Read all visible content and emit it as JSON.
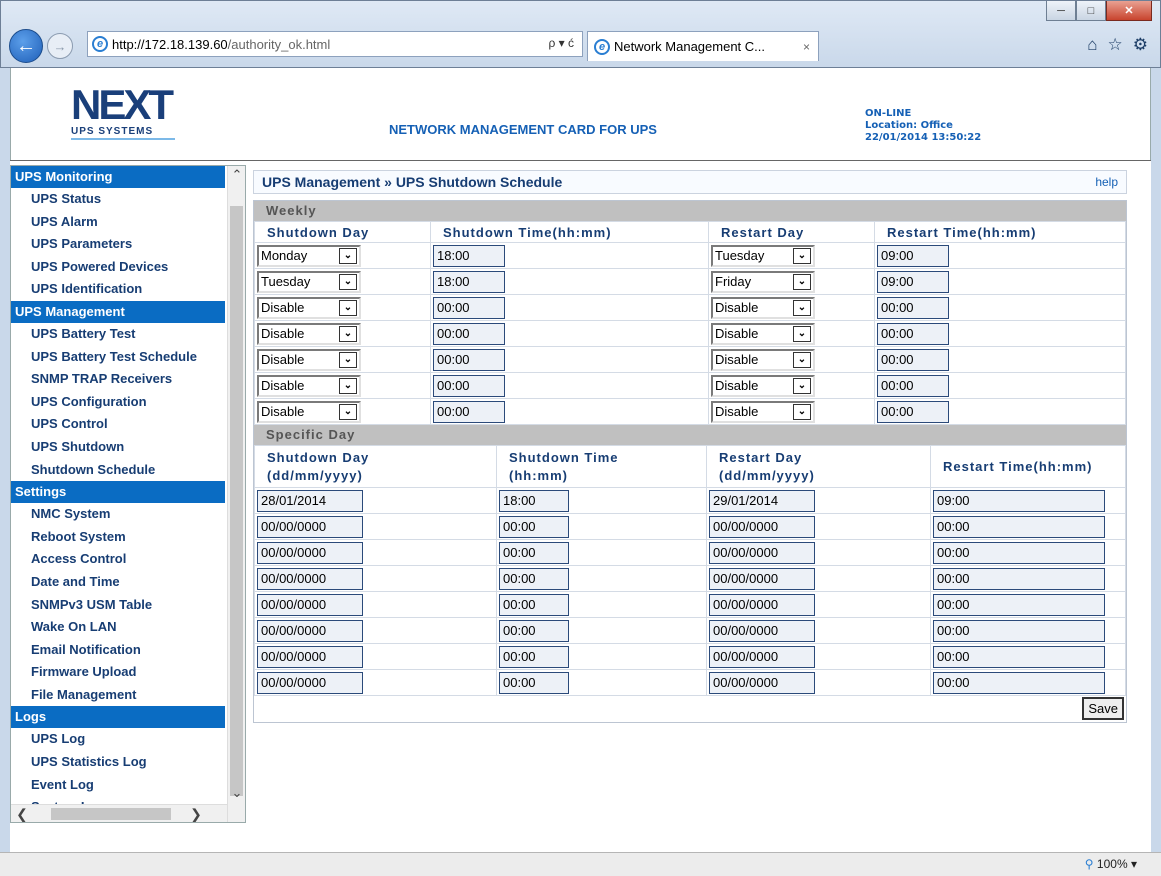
{
  "browser": {
    "url": "http://172.18.139.60/authority_ok.html",
    "url_host": "http://172.18.139.60",
    "url_path": "/authority_ok.html",
    "search_refresh": "ρ ▾ ć",
    "tab_title": "Network Management C...",
    "tab_close": "×",
    "zoom": "100%"
  },
  "banner": {
    "logo_main": "NEXT",
    "logo_sub": "UPS SYSTEMS",
    "title": "NETWORK MANAGEMENT CARD FOR UPS",
    "status": "ON-LINE",
    "location": "Location: Office",
    "datetime": "22/01/2014 13:50:22"
  },
  "sidebar": [
    {
      "section": "UPS Monitoring",
      "items": [
        "UPS Status",
        "UPS Alarm",
        "UPS Parameters",
        "UPS Powered Devices",
        "UPS Identification"
      ]
    },
    {
      "section": "UPS Management",
      "items": [
        "UPS Battery Test",
        "UPS Battery Test Schedule",
        "SNMP TRAP Receivers",
        "UPS Configuration",
        "UPS Control",
        "UPS Shutdown",
        "Shutdown Schedule"
      ]
    },
    {
      "section": "Settings",
      "items": [
        "NMC System",
        "Reboot System",
        "Access Control",
        "Date and Time",
        "SNMPv3 USM Table",
        "Wake On LAN",
        "Email Notification",
        "Firmware Upload",
        "File Management"
      ]
    },
    {
      "section": "Logs",
      "items": [
        "UPS Log",
        "UPS Statistics Log",
        "Event Log",
        "System Log"
      ]
    }
  ],
  "page": {
    "breadcrumb": "UPS Management » UPS Shutdown Schedule",
    "help": "help",
    "save_label": "Save"
  },
  "weekly": {
    "title": "Weekly",
    "headers": [
      "Shutdown Day",
      "Shutdown Time(hh:mm)",
      "Restart Day",
      "Restart Time(hh:mm)"
    ],
    "rows": [
      {
        "shutdown_day": "Monday",
        "shutdown_time": "18:00",
        "restart_day": "Tuesday",
        "restart_time": "09:00"
      },
      {
        "shutdown_day": "Tuesday",
        "shutdown_time": "18:00",
        "restart_day": "Friday",
        "restart_time": "09:00"
      },
      {
        "shutdown_day": "Disable",
        "shutdown_time": "00:00",
        "restart_day": "Disable",
        "restart_time": "00:00"
      },
      {
        "shutdown_day": "Disable",
        "shutdown_time": "00:00",
        "restart_day": "Disable",
        "restart_time": "00:00"
      },
      {
        "shutdown_day": "Disable",
        "shutdown_time": "00:00",
        "restart_day": "Disable",
        "restart_time": "00:00"
      },
      {
        "shutdown_day": "Disable",
        "shutdown_time": "00:00",
        "restart_day": "Disable",
        "restart_time": "00:00"
      },
      {
        "shutdown_day": "Disable",
        "shutdown_time": "00:00",
        "restart_day": "Disable",
        "restart_time": "00:00"
      }
    ]
  },
  "specific": {
    "title": "Specific Day",
    "headers": [
      {
        "line1": "Shutdown Day",
        "line2": "(dd/mm/yyyy)"
      },
      {
        "line1": "Shutdown Time",
        "line2": "(hh:mm)"
      },
      {
        "line1": "Restart Day",
        "line2": "(dd/mm/yyyy)"
      },
      {
        "line1": "Restart Time(hh:mm)",
        "line2": ""
      }
    ],
    "rows": [
      {
        "shutdown_day": "28/01/2014",
        "shutdown_time": "18:00",
        "restart_day": "29/01/2014",
        "restart_time": "09:00"
      },
      {
        "shutdown_day": "00/00/0000",
        "shutdown_time": "00:00",
        "restart_day": "00/00/0000",
        "restart_time": "00:00"
      },
      {
        "shutdown_day": "00/00/0000",
        "shutdown_time": "00:00",
        "restart_day": "00/00/0000",
        "restart_time": "00:00"
      },
      {
        "shutdown_day": "00/00/0000",
        "shutdown_time": "00:00",
        "restart_day": "00/00/0000",
        "restart_time": "00:00"
      },
      {
        "shutdown_day": "00/00/0000",
        "shutdown_time": "00:00",
        "restart_day": "00/00/0000",
        "restart_time": "00:00"
      },
      {
        "shutdown_day": "00/00/0000",
        "shutdown_time": "00:00",
        "restart_day": "00/00/0000",
        "restart_time": "00:00"
      },
      {
        "shutdown_day": "00/00/0000",
        "shutdown_time": "00:00",
        "restart_day": "00/00/0000",
        "restart_time": "00:00"
      },
      {
        "shutdown_day": "00/00/0000",
        "shutdown_time": "00:00",
        "restart_day": "00/00/0000",
        "restart_time": "00:00"
      }
    ]
  },
  "colors": {
    "section_bg": "#0a6cc3",
    "link": "#173d73",
    "accent": "#1560b5"
  }
}
